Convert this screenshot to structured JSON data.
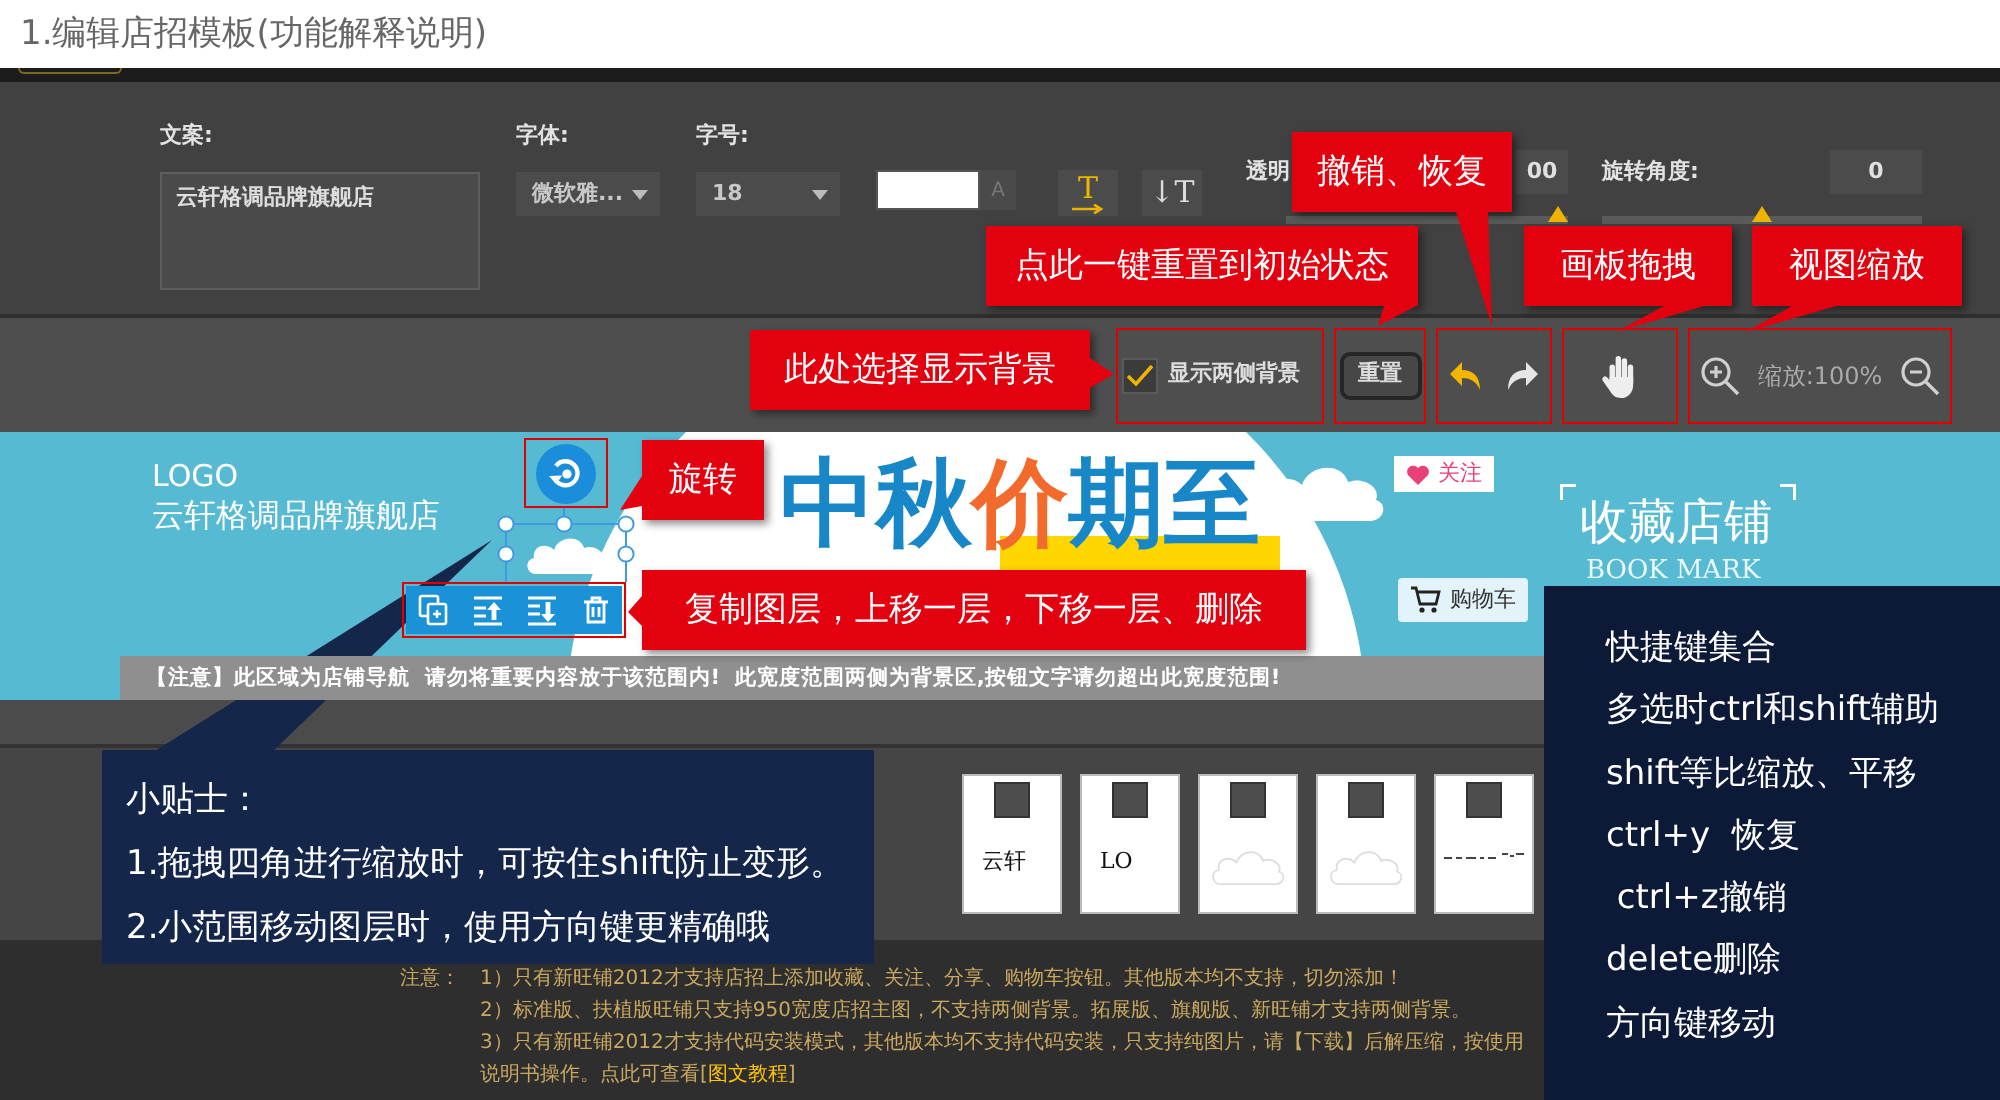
{
  "page_title": "1.编辑店招模板(功能解释说明)",
  "properties": {
    "copy": {
      "label": "文案:",
      "value": "云轩格调品牌旗舰店"
    },
    "font": {
      "label": "字体:",
      "value": "微软雅..."
    },
    "size": {
      "label": "字号:",
      "value": "18"
    },
    "color_letter": "A",
    "text_direction": [
      {
        "kind": "horizontal",
        "label": "T",
        "selected": true
      },
      {
        "kind": "vertical",
        "label": "↓T",
        "selected": false
      }
    ],
    "opacity": {
      "label": "透明",
      "value": "00",
      "level": 1
    },
    "rotation": {
      "label": "旋转角度:",
      "value": "0",
      "level": 0.5
    }
  },
  "toolbar": {
    "show_background": {
      "label": "显示两侧背景",
      "checked": true
    },
    "reset": "重置",
    "zoom": "缩放:100%"
  },
  "canvas": {
    "logo": "LOGO",
    "store_name": "云轩格调品牌旗舰店",
    "headline": [
      {
        "text": "中秋",
        "kind": "plain"
      },
      {
        "text": "价",
        "kind": "accent"
      },
      {
        "text": "期至",
        "kind": "plain"
      }
    ],
    "follow": "关注",
    "favorite": "收藏店铺",
    "favorite_subtitle": "BOOK MARK",
    "cart": "购物车",
    "notice": "【注意】此区域为店铺导航  请勿将重要内容放于该范围内!  此宽度范围两侧为背景区,按钮文字请勿超出此宽度范围!"
  },
  "layers": [
    {
      "kind": "text",
      "text": "云轩"
    },
    {
      "kind": "text",
      "text": "LO"
    },
    {
      "kind": "cloud"
    },
    {
      "kind": "cloud"
    },
    {
      "kind": "scribble"
    }
  ],
  "notes": {
    "label": "注意：",
    "lines": [
      "1）只有新旺铺2012才支持店招上添加收藏、关注、分享、购物车按钮。其他版本均不支持，切勿添加！",
      "2）标准版、扶植版旺铺只支持950宽度店招主图，不支持两侧背景。拓展版、旗舰版、新旺铺才支持两侧背景。",
      "3）只有新旺铺2012才支持代码安装模式，其他版本均不支持代码安装，只支持纯图片，请【下载】后解压缩，按使用"
    ],
    "last_line": {
      "text": "说明书操作。点此可查看[",
      "link": "图文教程",
      "end": "]"
    }
  },
  "callouts": [
    "撤销、恢复",
    "点此一键重置到初始状态",
    "画板拖拽",
    "视图缩放",
    "此处选择显示背景",
    "旋转",
    "复制图层，上移一层，下移一层、删除"
  ],
  "tips": {
    "title": "小贴士：",
    "lines": [
      "1.拖拽四角进行缩放时，可按住shift防止变形。",
      "2.小范围移动图层时，使用方向键更精确哦"
    ]
  },
  "shortcuts": {
    "title": "快捷键集合",
    "lines": [
      "多选时ctrl和shift辅助",
      "shift等比缩放、平移",
      "ctrl+y  恢复",
      " ctrl+z撤销",
      "delete删除",
      "方向键移动"
    ]
  }
}
